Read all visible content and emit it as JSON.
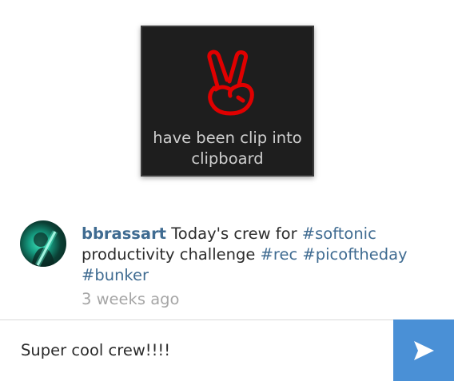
{
  "toast": {
    "icon": "victory-hand-icon",
    "message": "have been clip into clipboard",
    "icon_color": "#e00000"
  },
  "comment": {
    "username": "bbrassart",
    "text_1": " Today's crew for ",
    "hashtag_1": "#softonic",
    "text_2": " productivity challenge ",
    "hashtag_2": "#rec",
    "hashtag_3": "#picoftheday",
    "hashtag_4": "#bunker",
    "timestamp": "3 weeks ago"
  },
  "composer": {
    "value": "Super cool crew!!!!",
    "send_icon": "send-icon",
    "send_color": "#4a90d6"
  }
}
